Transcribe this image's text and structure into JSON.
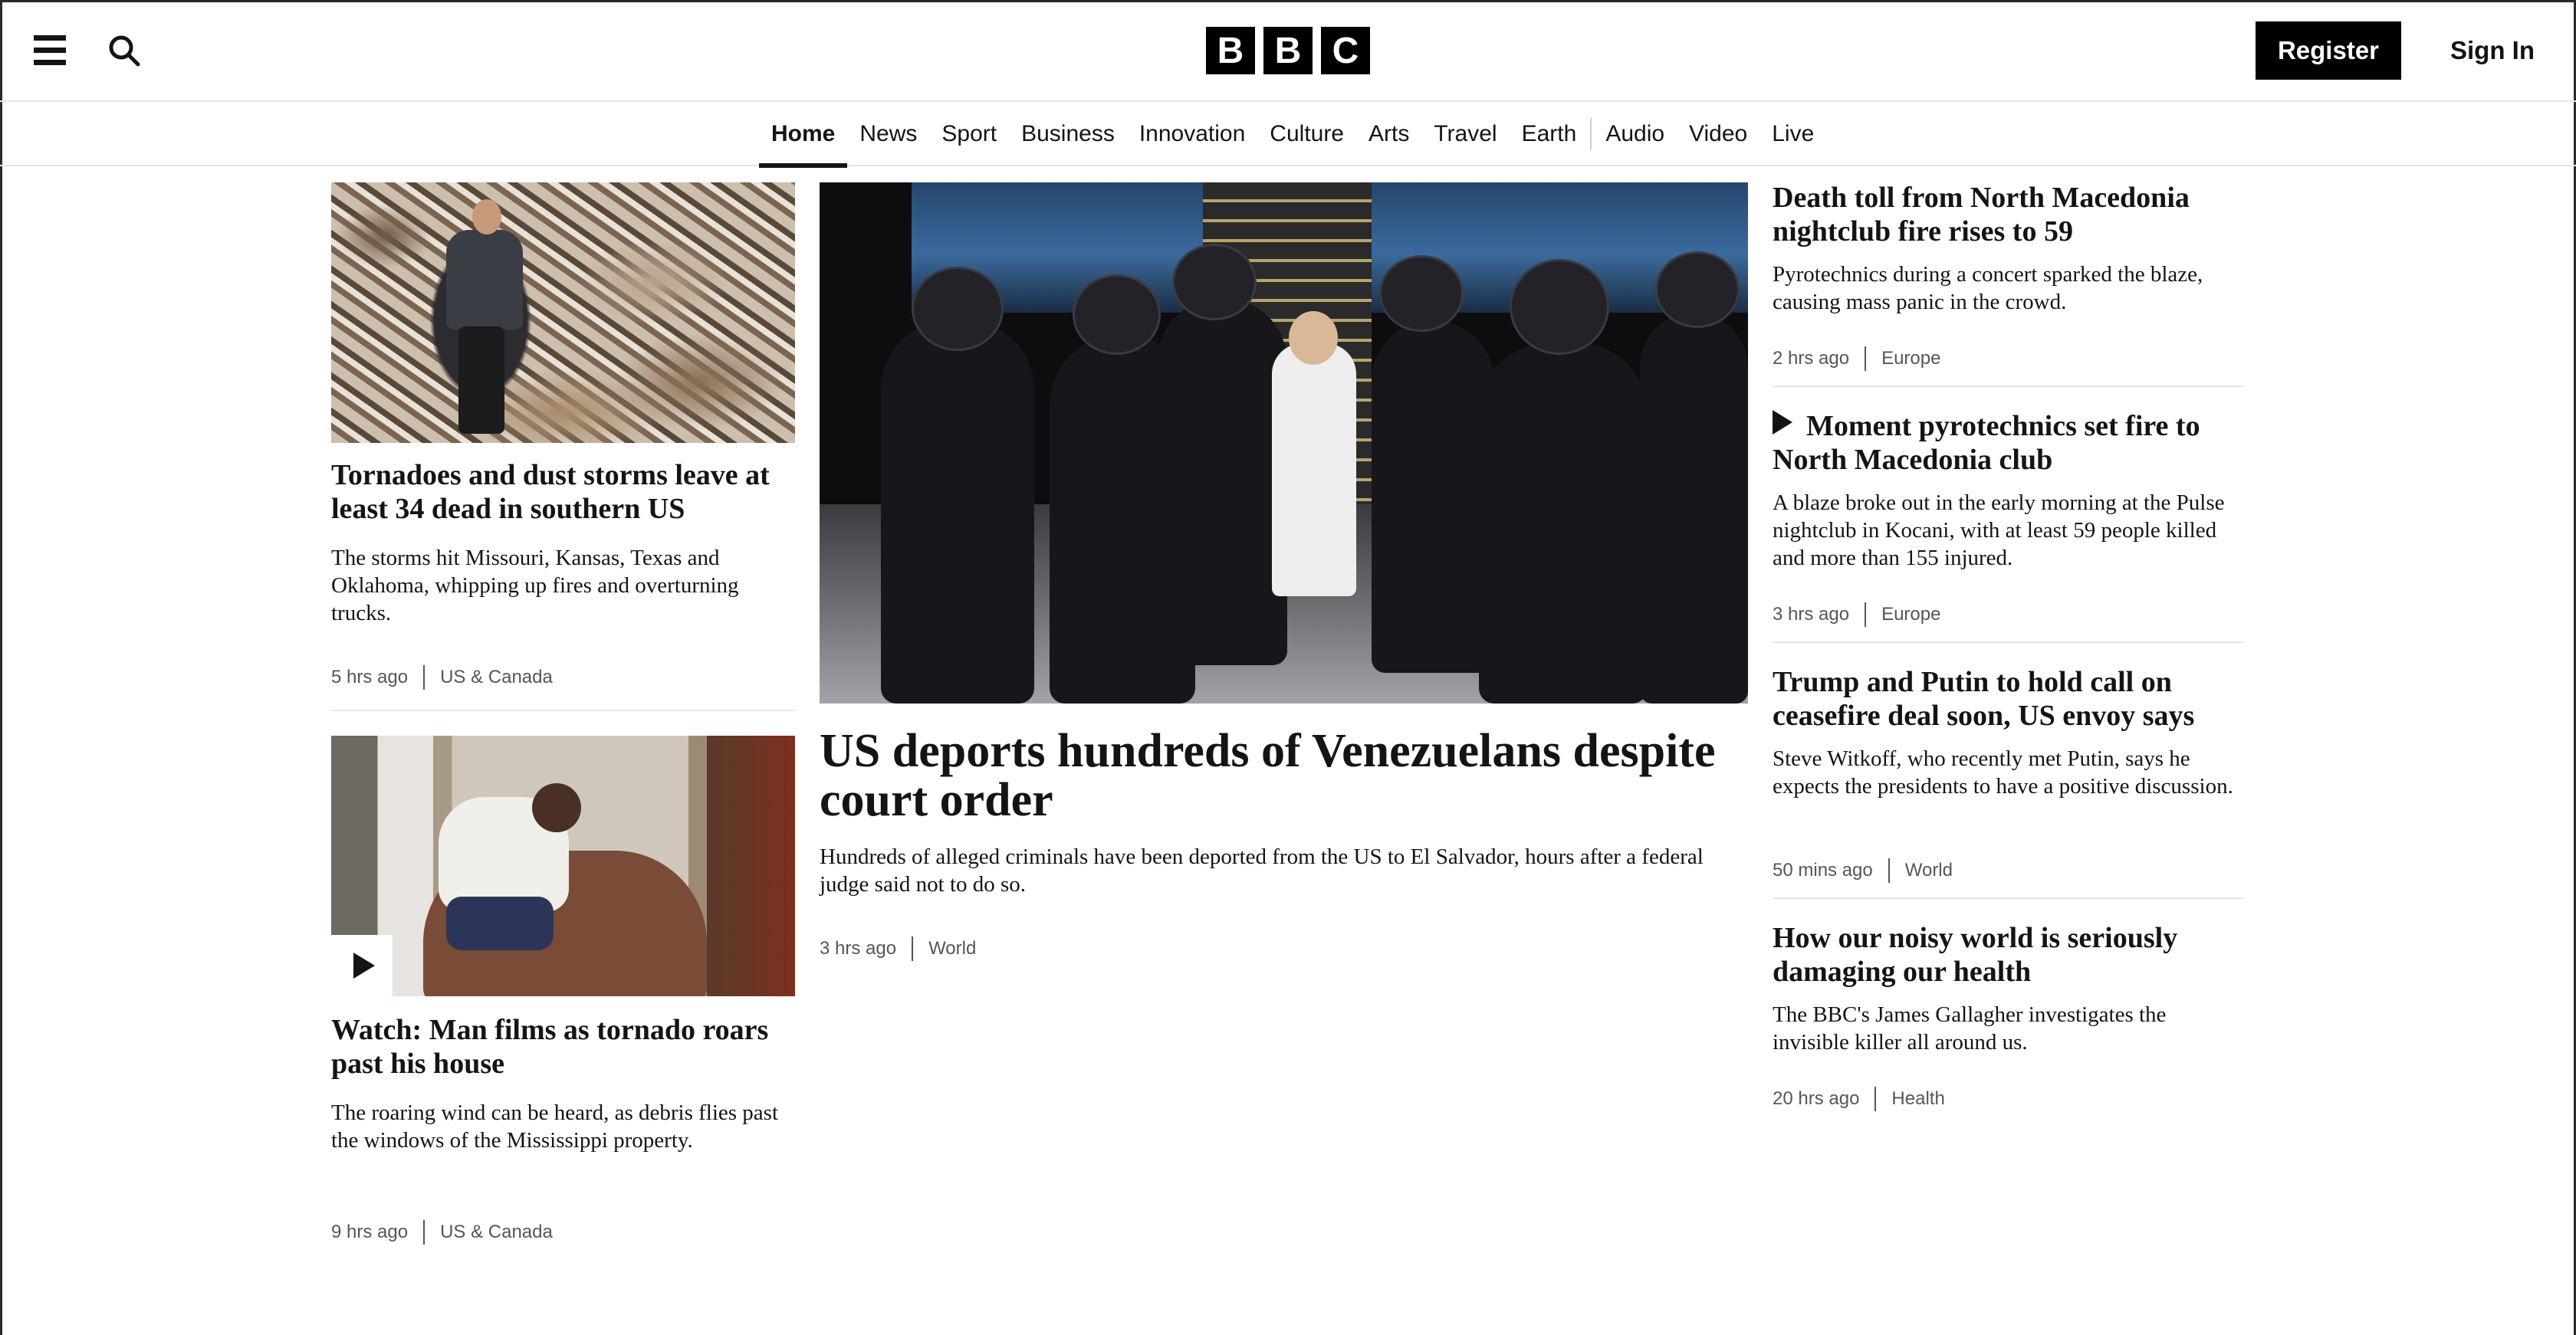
{
  "header": {
    "logo_letters": [
      "B",
      "B",
      "C"
    ],
    "register_label": "Register",
    "signin_label": "Sign In",
    "menu_icon": "hamburger-menu-icon",
    "search_icon": "search-icon"
  },
  "nav": {
    "items": [
      "Home",
      "News",
      "Sport",
      "Business",
      "Innovation",
      "Culture",
      "Arts",
      "Travel",
      "Earth",
      "Audio",
      "Video",
      "Live"
    ],
    "active": "Home"
  },
  "stories": {
    "left_1": {
      "headline": "Tornadoes and dust storms leave at least 34 dead in southern US",
      "summary": "The storms hit Missouri, Kansas, Texas and Oklahoma, whipping up fires and overturning trucks.",
      "time": "5 hrs ago",
      "category": "US & Canada"
    },
    "left_2": {
      "headline": "Watch: Man films as tornado roars past his house",
      "summary": "The roaring wind can be heard, as debris flies past the windows of the Mississippi property.",
      "time": "9 hrs ago",
      "category": "US & Canada",
      "media_icon": "play-icon"
    },
    "main": {
      "headline": "US deports hundreds of Venezuelans despite court order",
      "summary": "Hundreds of alleged criminals have been deported from the US to El Salvador, hours after a federal judge said not to do so.",
      "time": "3 hrs ago",
      "category": "World"
    },
    "right_1": {
      "headline": "Death toll from North Macedonia nightclub fire rises to 59",
      "summary": "Pyrotechnics during a concert sparked the blaze, causing mass panic in the crowd.",
      "time": "2 hrs ago",
      "category": "Europe"
    },
    "right_2": {
      "headline": "Moment pyrotechnics set fire to North Macedonia club",
      "summary": "A blaze broke out in the early morning at the Pulse nightclub in Kocani, with at least 59 people killed and more than 155 injured.",
      "time": "3 hrs ago",
      "category": "Europe",
      "media_icon": "play-icon"
    },
    "right_3": {
      "headline": "Trump and Putin to hold call on ceasefire deal soon, US envoy says",
      "summary": "Steve Witkoff, who recently met Putin, says he expects the presidents to have a positive discussion.",
      "time": "50 mins ago",
      "category": "World"
    },
    "right_4": {
      "headline": "How our noisy world is seriously damaging our health",
      "summary": "The BBC's James Gallagher investigates the invisible killer all around us.",
      "time": "20 hrs ago",
      "category": "Health"
    }
  },
  "colors": {
    "text": "#141414",
    "meta": "#545658",
    "divider": "#e6e6e6",
    "button_bg": "#000000"
  }
}
